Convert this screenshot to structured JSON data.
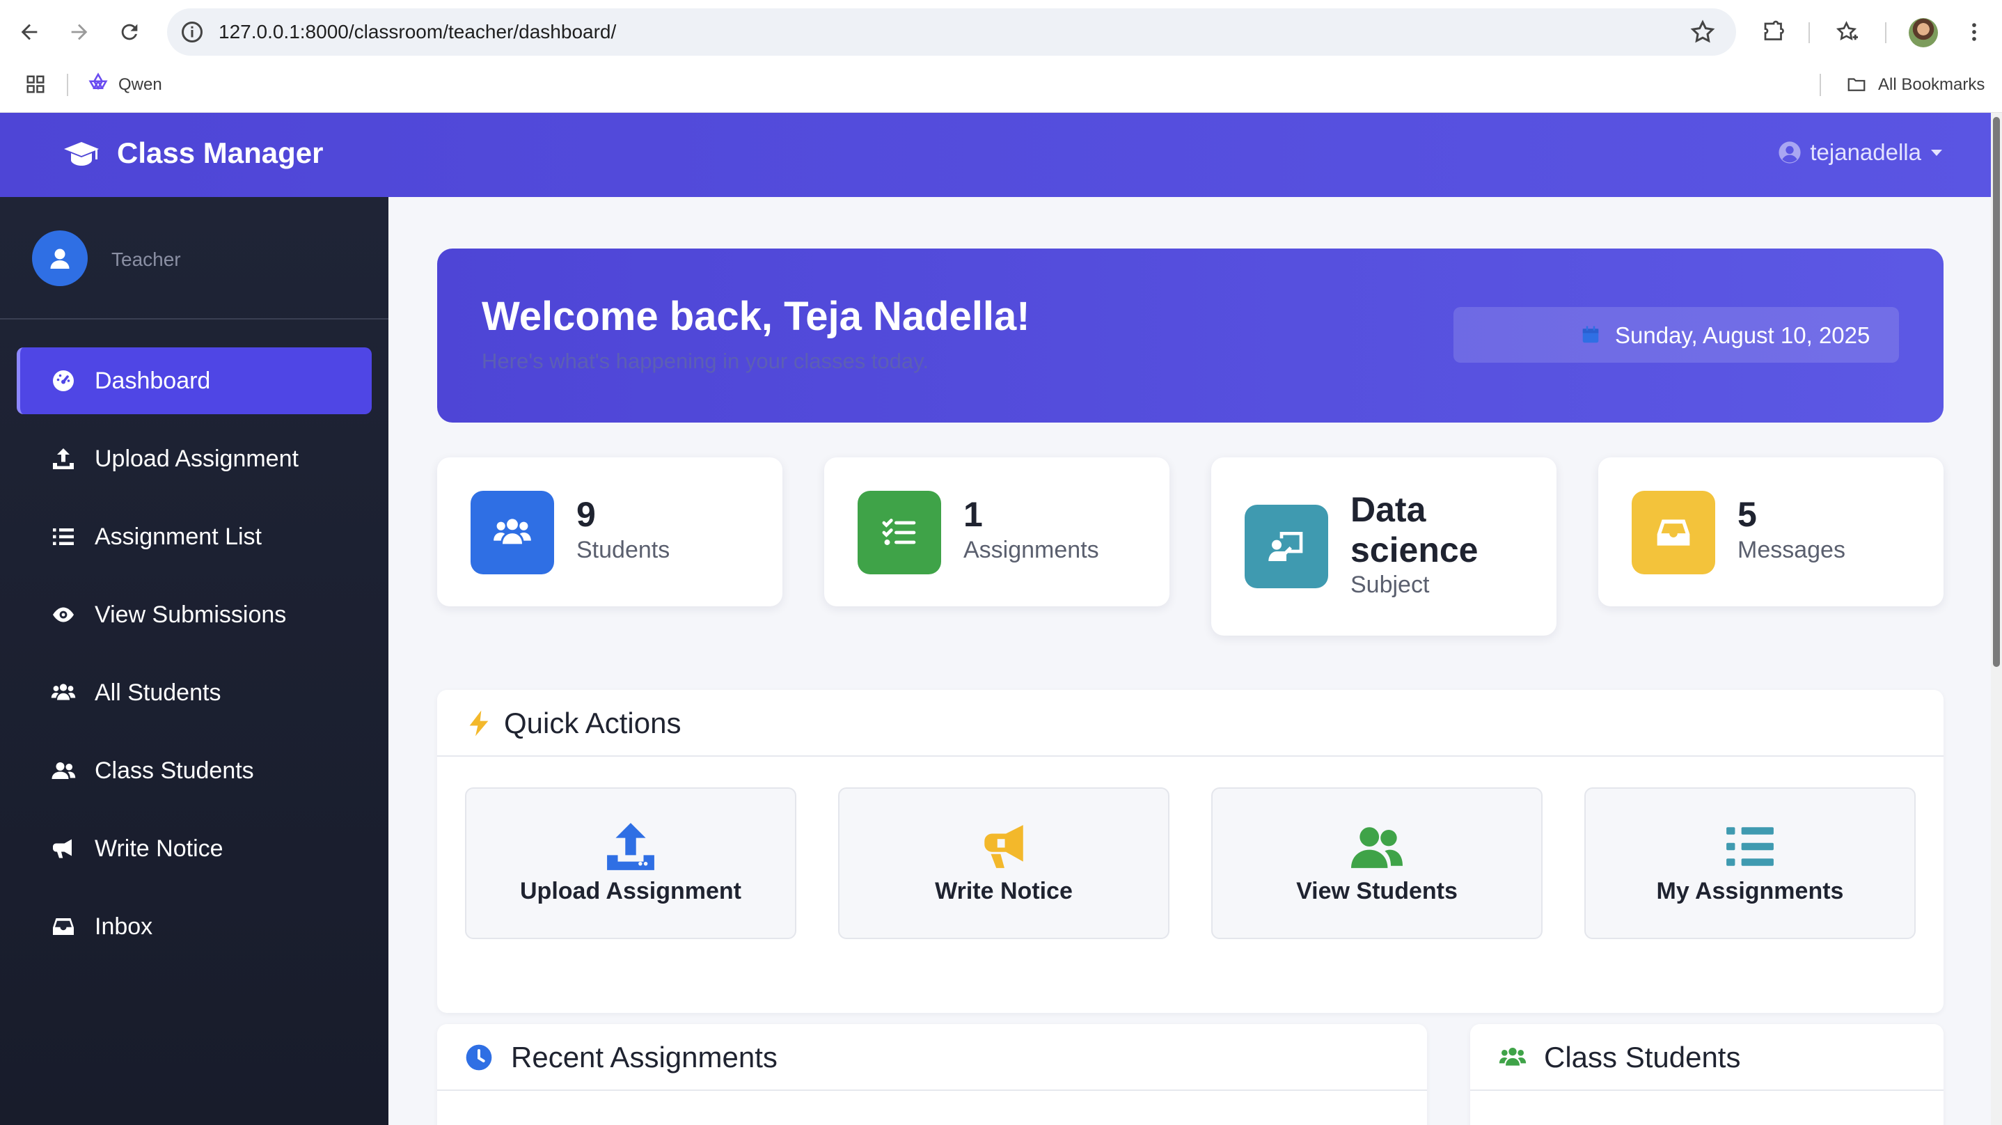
{
  "browser": {
    "url": "127.0.0.1:8000/classroom/teacher/dashboard/",
    "bookmarks": [
      {
        "label": "Qwen",
        "icon": "qwen-icon"
      }
    ],
    "all_bookmarks_label": "All Bookmarks"
  },
  "header": {
    "brand": "Class Manager",
    "brand_icon": "graduation-cap-icon",
    "username": "tejanadella",
    "accent_color": "#4f46e5"
  },
  "sidebar": {
    "role": "Teacher",
    "items": [
      {
        "label": "Dashboard",
        "icon": "tachometer-icon",
        "active": true
      },
      {
        "label": "Upload Assignment",
        "icon": "upload-icon"
      },
      {
        "label": "Assignment List",
        "icon": "list-icon"
      },
      {
        "label": "View Submissions",
        "icon": "eye-icon"
      },
      {
        "label": "All Students",
        "icon": "users-icon"
      },
      {
        "label": "Class Students",
        "icon": "user-friends-icon"
      },
      {
        "label": "Write Notice",
        "icon": "bullhorn-icon"
      },
      {
        "label": "Inbox",
        "icon": "inbox-icon"
      }
    ]
  },
  "welcome": {
    "title": "Welcome back, Teja Nadella!",
    "subtitle": "Here's what's happening in your classes today.",
    "date": "Sunday, August 10, 2025"
  },
  "stats": [
    {
      "value": "9",
      "label": "Students",
      "color": "#2f6fe4",
      "icon": "users-icon"
    },
    {
      "value": "1",
      "label": "Assignments",
      "color": "#3fa348",
      "icon": "tasks-icon"
    },
    {
      "value": "Data science",
      "label": "Subject",
      "color": "#3f9ab0",
      "icon": "chalkboard-teacher-icon"
    },
    {
      "value": "5",
      "label": "Messages",
      "color": "#f3c33b",
      "icon": "inbox-icon"
    }
  ],
  "quick_actions": {
    "title": "Quick Actions",
    "items": [
      {
        "label": "Upload Assignment",
        "icon": "upload-icon",
        "color": "#2f6fe4"
      },
      {
        "label": "Write Notice",
        "icon": "bullhorn-icon",
        "color": "#f3b82b"
      },
      {
        "label": "View Students",
        "icon": "users-icon",
        "color": "#3fa348"
      },
      {
        "label": "My Assignments",
        "icon": "list-icon",
        "color": "#3f9ab0"
      }
    ]
  },
  "panels": {
    "recent_assignments": "Recent Assignments",
    "class_students": "Class Students"
  }
}
